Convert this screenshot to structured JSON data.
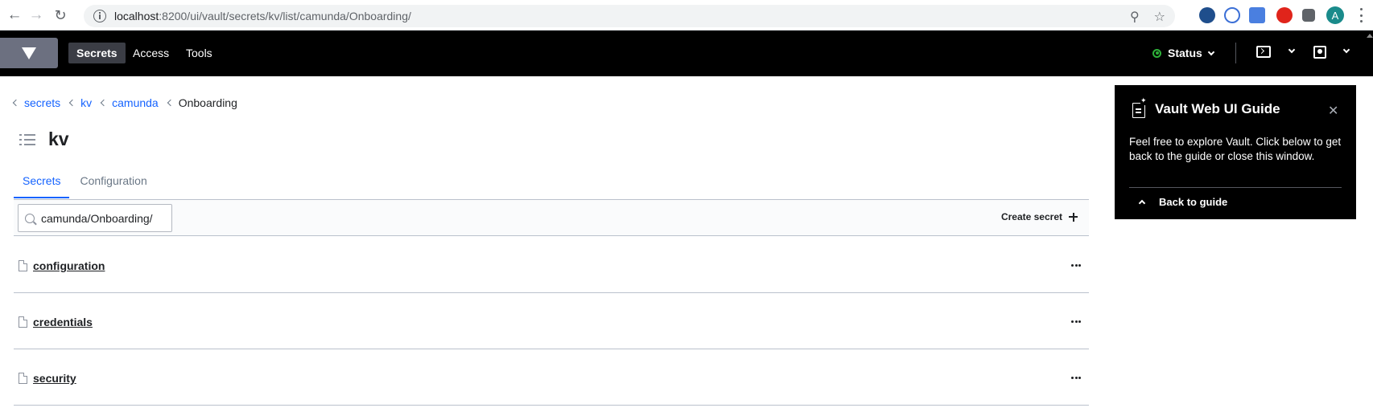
{
  "browser": {
    "url_host": "localhost",
    "url_path": ":8200/ui/vault/secrets/kv/list/camunda/Onboarding/",
    "avatar_letter": "A"
  },
  "nav": {
    "links": [
      "Secrets",
      "Access",
      "Tools"
    ],
    "status_label": "Status"
  },
  "breadcrumb": {
    "items": [
      "secrets",
      "kv",
      "camunda"
    ],
    "current": "Onboarding"
  },
  "page": {
    "title": "kv",
    "tabs": [
      "Secrets",
      "Configuration"
    ]
  },
  "toolbar": {
    "search_value": "camunda/Onboarding/",
    "create_label": "Create secret"
  },
  "secrets": [
    "configuration",
    "credentials",
    "security"
  ],
  "guide": {
    "title": "Vault Web UI Guide",
    "body": "Feel free to explore Vault. Click below to get back to the guide or close this window.",
    "back_label": "Back to guide"
  },
  "colors": {
    "accent": "#1563ff",
    "nav_bg": "#000000",
    "status_ok": "#2eb039"
  }
}
